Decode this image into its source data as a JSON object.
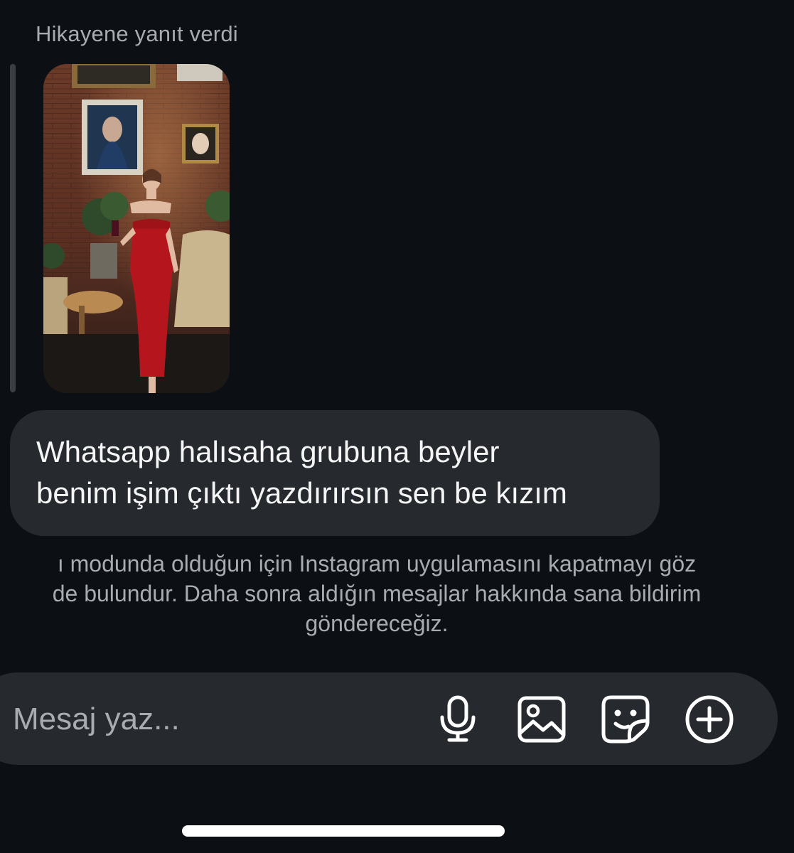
{
  "story_reply": {
    "header": "Hikayene yanıt verdi"
  },
  "message": {
    "text": "Whatsapp halısaha grubuna beyler\nbenim işim çıktı yazdırırsın sen be kızım"
  },
  "notice": {
    "lines": [
      "ı modunda olduğun için Instagram uygulamasını kapatmayı göz",
      "de bulundur. Daha sonra aldığın mesajlar hakkında sana bildirim",
      "göndereceğiz."
    ]
  },
  "composer": {
    "placeholder": "Mesaj yaz...",
    "icons": [
      "microphone-icon",
      "image-icon",
      "sticker-icon",
      "plus-circle-icon"
    ]
  },
  "colors": {
    "background": "#0c1014",
    "bubble": "#262a2f",
    "secondary_text": "#a8acb1"
  }
}
